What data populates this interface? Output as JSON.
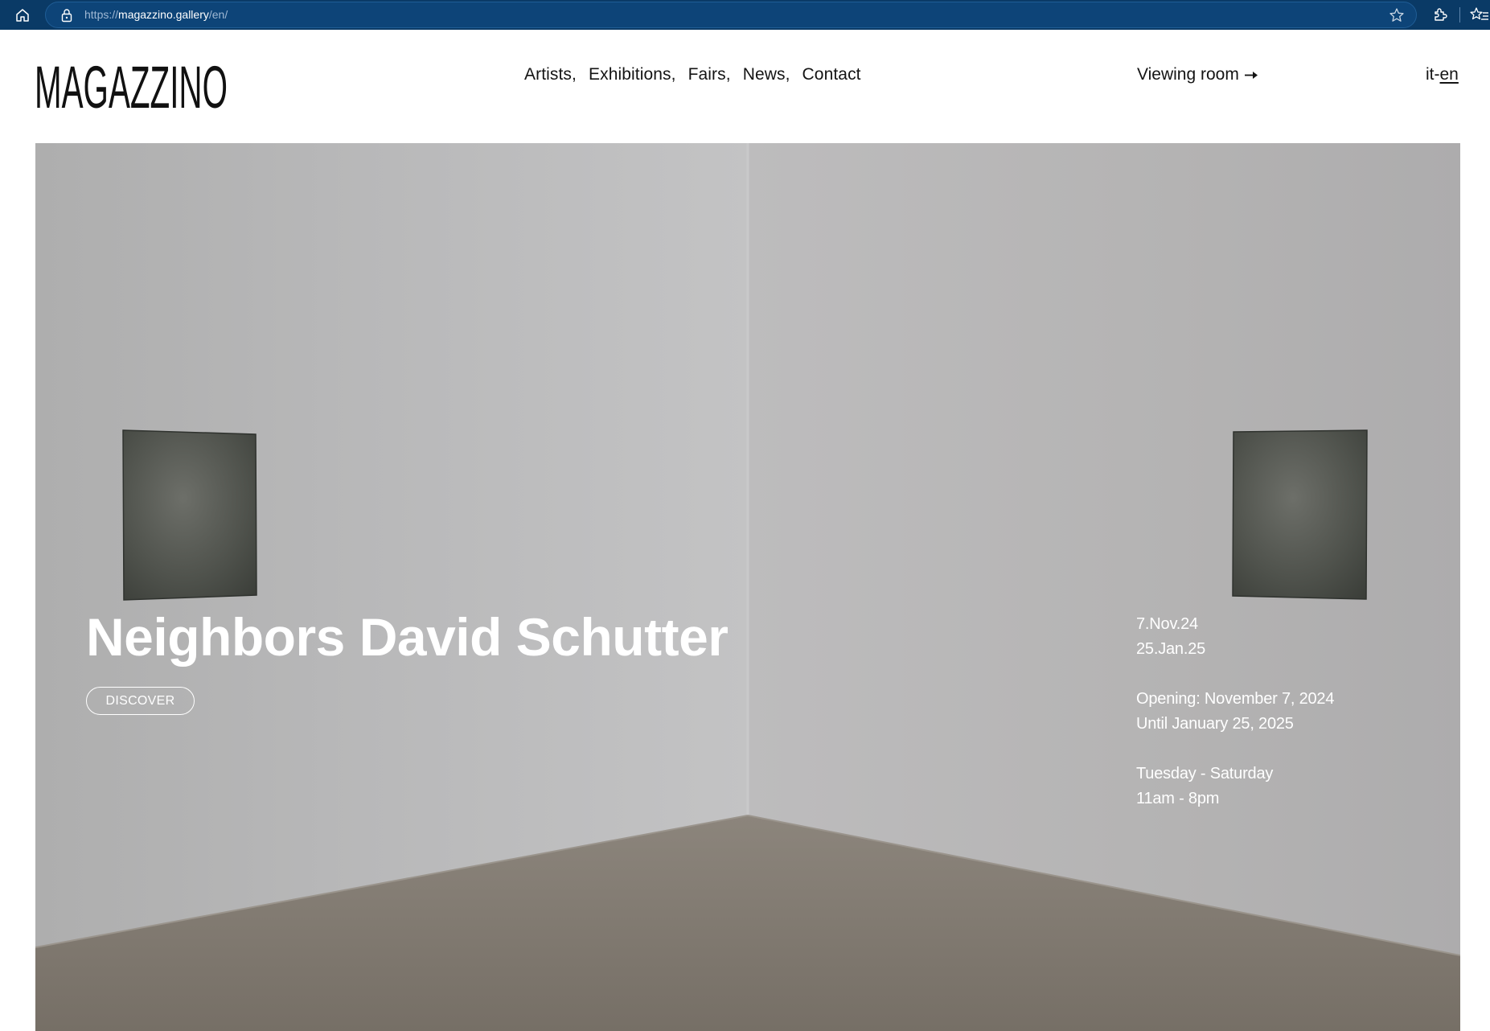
{
  "browser": {
    "url_scheme": "https://",
    "url_host": "magazzino.gallery",
    "url_path": "/en/"
  },
  "header": {
    "logo_text": "MAGAZZINO",
    "nav": [
      "Artists,",
      "Exhibitions,",
      "Fairs,",
      "News,",
      "Contact"
    ],
    "viewing_room": "Viewing room",
    "lang_it": "it",
    "lang_sep": "-",
    "lang_en": "en"
  },
  "hero": {
    "title": "Neighbors David Schutter",
    "cta": "DISCOVER",
    "date_start": "7.Nov.24",
    "date_end": "25.Jan.25",
    "opening": "Opening: November 7, 2024",
    "until": "Until January 25, 2025",
    "days": "Tuesday - Saturday",
    "hours": "11am - 8pm"
  },
  "icons": {
    "home": "home-icon",
    "lock": "lock-icon",
    "star": "star-icon",
    "extensions": "puzzle-icon",
    "favorites": "favorites-icon",
    "arrow": "arrow-right-icon"
  },
  "colors": {
    "browser_bar": "#0a3a66",
    "text": "#141414",
    "hero_text": "#ffffff"
  }
}
